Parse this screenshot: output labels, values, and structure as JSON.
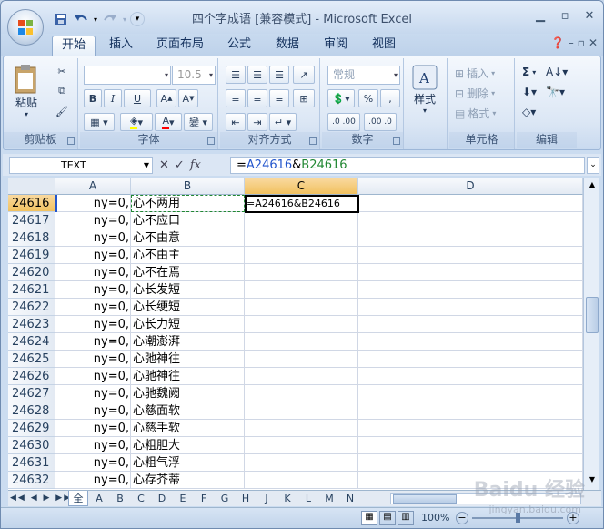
{
  "title": "四个字成语  [兼容模式] - Microsoft Excel",
  "tabs": [
    "开始",
    "插入",
    "页面布局",
    "公式",
    "数据",
    "审阅",
    "视图"
  ],
  "ribbon": {
    "clipboard": {
      "label": "剪贴板",
      "paste": "粘贴"
    },
    "font": {
      "label": "字体",
      "size": "10.5",
      "bold": "B",
      "italic": "I",
      "underline": "U"
    },
    "alignment": {
      "label": "对齐方式"
    },
    "number": {
      "label": "数字",
      "format": "常规",
      "percent": "%",
      "comma": ",",
      "inc": ".0 .00",
      "dec": ".00 .0"
    },
    "styles": {
      "label": "样式"
    },
    "cells": {
      "label": "单元格",
      "insert": "插入",
      "delete": "删除",
      "format": "格式"
    },
    "editing": {
      "label": "编辑",
      "sigma": "Σ"
    }
  },
  "formula_bar": {
    "name_box": "TEXT",
    "formula_prefix": "=",
    "ref_a": "A24616",
    "amp": "&",
    "ref_b": "B24616"
  },
  "columns": [
    "A",
    "B",
    "C",
    "D"
  ],
  "rows": [
    {
      "num": "24616",
      "a": "ny=0,",
      "b": "心不两用",
      "c": "=A24616&B24616"
    },
    {
      "num": "24617",
      "a": "ny=0,",
      "b": "心不应口",
      "c": ""
    },
    {
      "num": "24618",
      "a": "ny=0,",
      "b": "心不由意",
      "c": ""
    },
    {
      "num": "24619",
      "a": "ny=0,",
      "b": "心不由主",
      "c": ""
    },
    {
      "num": "24620",
      "a": "ny=0,",
      "b": "心不在焉",
      "c": ""
    },
    {
      "num": "24621",
      "a": "ny=0,",
      "b": "心长发短",
      "c": ""
    },
    {
      "num": "24622",
      "a": "ny=0,",
      "b": "心长绠短",
      "c": ""
    },
    {
      "num": "24623",
      "a": "ny=0,",
      "b": "心长力短",
      "c": ""
    },
    {
      "num": "24624",
      "a": "ny=0,",
      "b": "心潮澎湃",
      "c": ""
    },
    {
      "num": "24625",
      "a": "ny=0,",
      "b": "心弛神往",
      "c": ""
    },
    {
      "num": "24626",
      "a": "ny=0,",
      "b": "心驰神往",
      "c": ""
    },
    {
      "num": "24627",
      "a": "ny=0,",
      "b": "心驰魏阙",
      "c": ""
    },
    {
      "num": "24628",
      "a": "ny=0,",
      "b": "心慈面软",
      "c": ""
    },
    {
      "num": "24629",
      "a": "ny=0,",
      "b": "心慈手软",
      "c": ""
    },
    {
      "num": "24630",
      "a": "ny=0,",
      "b": "心粗胆大",
      "c": ""
    },
    {
      "num": "24631",
      "a": "ny=0,",
      "b": "心粗气浮",
      "c": ""
    },
    {
      "num": "24632",
      "a": "ny=0,",
      "b": "心存芥蒂",
      "c": ""
    }
  ],
  "sheet_tabs": [
    "全",
    "A",
    "B",
    "C",
    "D",
    "E",
    "F",
    "G",
    "H",
    "J",
    "K",
    "L",
    "M",
    "N"
  ],
  "status": {
    "zoom": "100%"
  },
  "watermark": {
    "brand": "Baidu 经验",
    "url": "jingyan.baidu.com"
  },
  "colors": {
    "selected_header": "#f1c15f",
    "ref_a": "#2255cc",
    "ref_b": "#228833"
  }
}
